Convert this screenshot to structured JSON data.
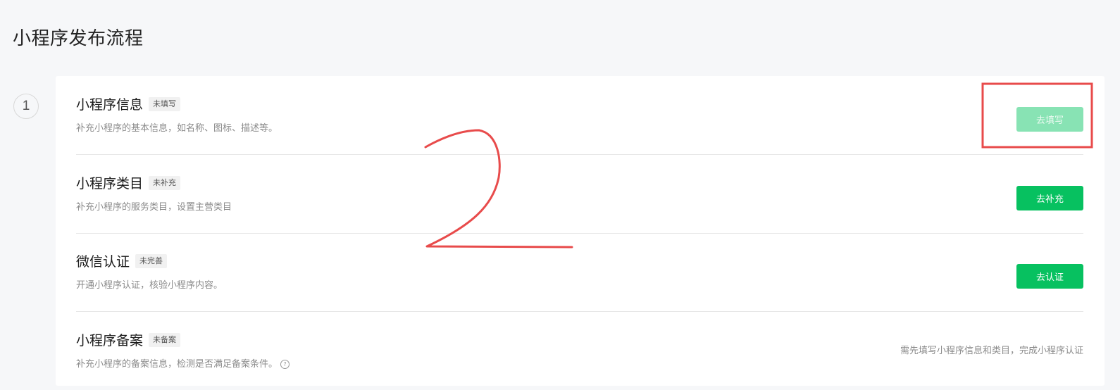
{
  "page": {
    "title": "小程序发布流程"
  },
  "step": {
    "number": "1"
  },
  "rows": [
    {
      "title": "小程序信息",
      "badge": "未填写",
      "desc": "补充小程序的基本信息，如名称、图标、描述等。",
      "action": "去填写",
      "state": "disabled"
    },
    {
      "title": "小程序类目",
      "badge": "未补充",
      "desc": "补充小程序的服务类目，设置主营类目",
      "action": "去补充",
      "state": "enabled"
    },
    {
      "title": "微信认证",
      "badge": "未完善",
      "desc": "开通小程序认证，核验小程序内容。",
      "action": "去认证",
      "state": "enabled"
    },
    {
      "title": "小程序备案",
      "badge": "未备案",
      "desc": "补充小程序的备案信息，检测是否满足备案条件。",
      "help_icon": "?",
      "note": "需先填写小程序信息和类目，完成小程序认证"
    }
  ],
  "annotation": {
    "handwritten_text": "2",
    "color": "#e84b4b"
  },
  "colors": {
    "primary": "#07c160",
    "primary_disabled": "#88e3b4"
  }
}
